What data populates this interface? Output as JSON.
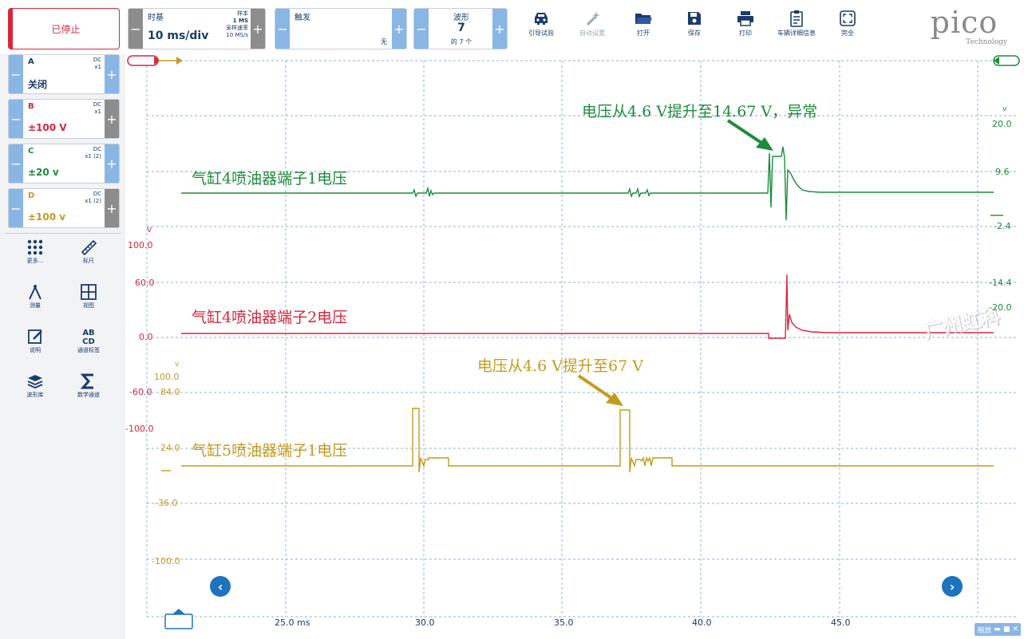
{
  "toolbar": {
    "stop_label": "已停止",
    "timebase_title": "时基",
    "timebase_value": "10 ms/div",
    "samples_label": "样本",
    "samples_value": "1 MS",
    "rate_label": "采样速率",
    "rate_value": "10 MS/s",
    "trigger_title": "触发",
    "trigger_value": "无",
    "waveform_title": "波形",
    "waveform_value": "7",
    "waveform_of": "的 7 个",
    "buttons": [
      {
        "label": "引导试验",
        "icon": "car-icon"
      },
      {
        "label": "自动设置",
        "icon": "magic-wand-icon"
      },
      {
        "label": "打开",
        "icon": "folder-icon"
      },
      {
        "label": "保存",
        "icon": "save-icon"
      },
      {
        "label": "打印",
        "icon": "print-icon"
      },
      {
        "label": "车辆详细信息",
        "icon": "clipboard-icon"
      },
      {
        "label": "完全",
        "icon": "fullscreen-icon"
      }
    ],
    "logo_text": "pico",
    "logo_sub": "Technology"
  },
  "channels": [
    {
      "name": "A",
      "coupling": "DC",
      "probe": "x1",
      "range": "关闭",
      "color": "#1b3b6b"
    },
    {
      "name": "B",
      "coupling": "DC",
      "probe": "x1",
      "range": "±100 V",
      "color": "#d7263d"
    },
    {
      "name": "C",
      "coupling": "DC",
      "probe": "x1 (2)",
      "range": "±20 v",
      "color": "#1e8a3c"
    },
    {
      "name": "D",
      "coupling": "DC",
      "probe": "x1 (2)",
      "range": "±100 v",
      "color": "#c49a1e"
    }
  ],
  "tools": [
    {
      "label": "更多...",
      "icon": "dots-grid-icon"
    },
    {
      "label": "标尺",
      "icon": "ruler-icon"
    },
    {
      "label": "测量",
      "icon": "compass-icon"
    },
    {
      "label": "视图",
      "icon": "grid-view-icon"
    },
    {
      "label": "说明",
      "icon": "note-icon"
    },
    {
      "label": "通道标签",
      "icon": "abcd-icon"
    },
    {
      "label": "波形库",
      "icon": "layers-icon"
    },
    {
      "label": "数学通道",
      "icon": "sigma-icon"
    }
  ],
  "plot": {
    "x_ticks": [
      "25.0 ms",
      "30.0",
      "35.0",
      "40.0",
      "45.0"
    ],
    "green_axis": {
      "unit": "v",
      "ticks": [
        "20.0",
        "9.6",
        "-2.4",
        "-14.4",
        "-20.0"
      ]
    },
    "red_axis": {
      "unit": "V",
      "ticks": [
        "100.0",
        "60.0",
        "0.0",
        "-60.0",
        "-100.0"
      ]
    },
    "gold_axis": {
      "unit": "v",
      "ticks": [
        "100.0",
        "84.0",
        "24.0",
        "-36.0",
        "-100.0"
      ]
    },
    "labels": {
      "green_trace": "气缸4喷油器端子1电压",
      "red_trace": "气缸4喷油器端子2电压",
      "gold_trace": "气缸5喷油器端子1电压",
      "green_annotation": "电压从4.6 V提升至14.67 V，异常",
      "gold_annotation": "电压从4.6 V提升至67 V",
      "watermark": "广州虹科"
    },
    "zoom_label": "缩放",
    "colors": {
      "green": "#1e8a3c",
      "red": "#d7263d",
      "gold": "#c49a1e",
      "grid": "#8ab6d6"
    }
  }
}
